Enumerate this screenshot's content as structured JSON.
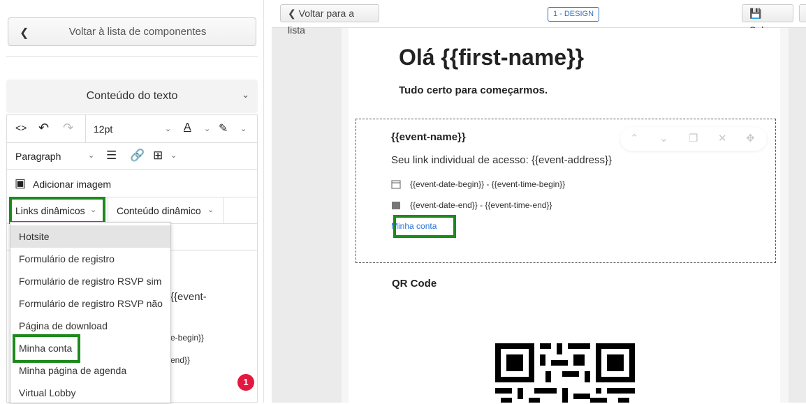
{
  "left": {
    "back_button": "Voltar à lista de componentes",
    "accordion_title": "Conteúdo do texto",
    "font_size": "12pt",
    "block_format": "Paragraph",
    "add_image": "Adicionar imagem",
    "dynamic_links": "Links dinâmicos",
    "dynamic_content": "Conteúdo dinâmico",
    "dropdown_items": [
      "Hotsite",
      "Formulário de registro",
      "Formulário de registro RSVP sim",
      "Formulário de registro RSVP não",
      "Página de download",
      "Minha conta",
      "Minha página de agenda",
      "Virtual Lobby"
    ],
    "behind_text_1": "{{event-",
    "behind_text_2": "e-begin}}",
    "behind_text_3": "end}}",
    "badge": "1"
  },
  "topbar": {
    "back_button": "Voltar para a lista",
    "design_tag": "1 - DESIGN",
    "save_button": "Salvar"
  },
  "email": {
    "greeting": "Olá {{first-name}}",
    "subtitle": "Tudo certo para começarmos.",
    "event_name": "{{event-name}}",
    "event_link": "Seu link individual de acesso: {{event-address}}",
    "date_begin": "{{event-date-begin}} - {{event-time-begin}}",
    "date_end": "{{event-date-end}} - {{event-time-end}}",
    "my_account": "Minha conta",
    "qr_title": "QR Code"
  },
  "colors": {
    "highlight": "#1e8a1e",
    "link": "#2a74d8",
    "badge": "#e5173f"
  }
}
